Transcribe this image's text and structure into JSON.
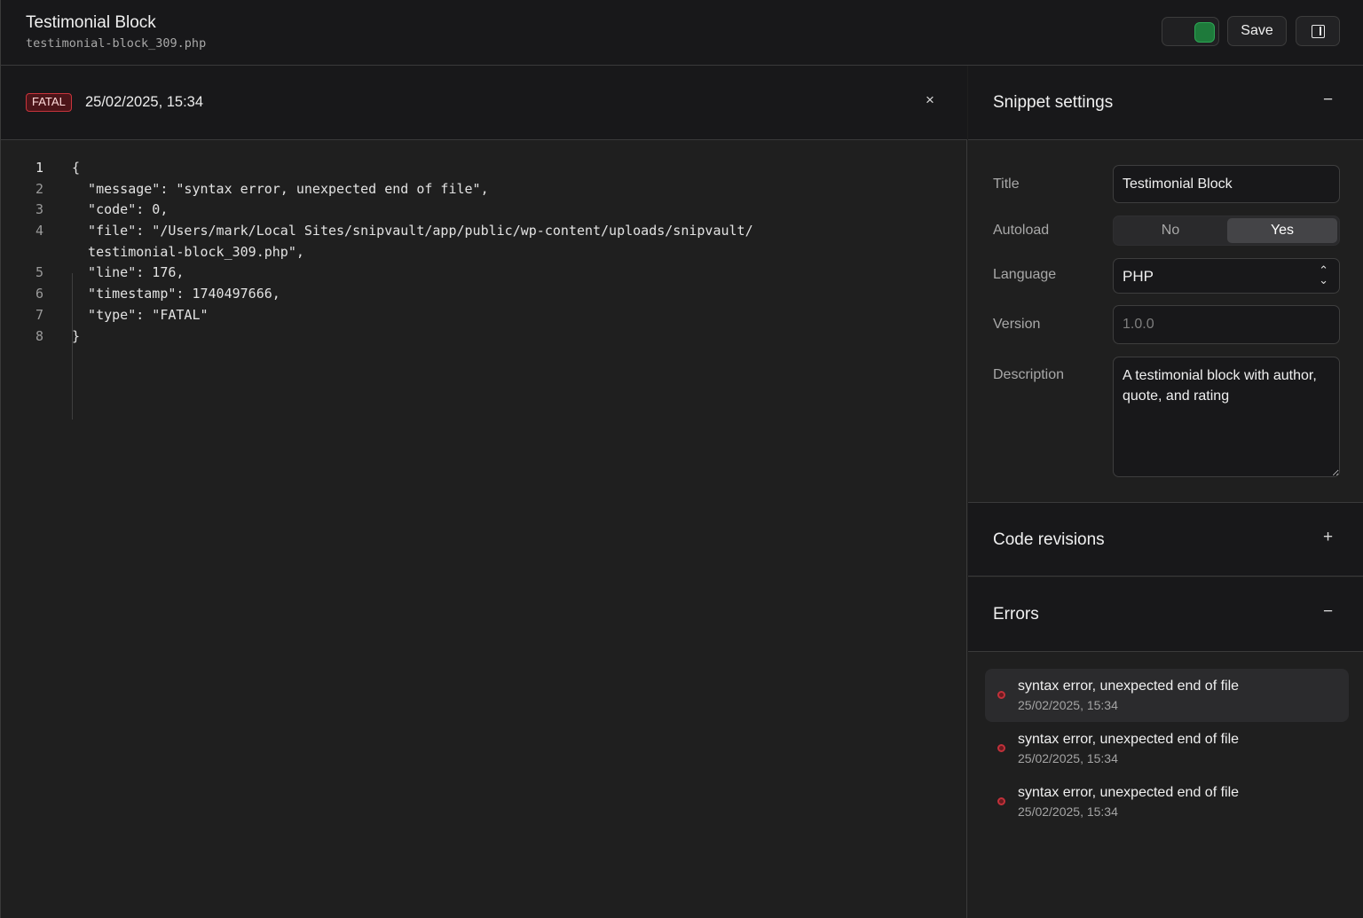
{
  "header": {
    "title": "Testimonial Block",
    "filename": "testimonial-block_309.php",
    "save_label": "Save",
    "toggle_state": "on",
    "accent_color": "#2da654"
  },
  "error_view": {
    "badge": "FATAL",
    "date": "25/02/2025, 15:34",
    "close_icon": "close-icon",
    "close_glyph": "×",
    "code_lines": [
      {
        "num": "1",
        "text": "{"
      },
      {
        "num": "2",
        "text": "  \"message\": \"syntax error, unexpected end of file\","
      },
      {
        "num": "3",
        "text": "  \"code\": 0,"
      },
      {
        "num": "4",
        "text": "  \"file\": \"/Users/mark/Local Sites/snipvault/app/public/wp-content/uploads/snipvault/"
      },
      {
        "num": "",
        "text": "  testimonial-block_309.php\","
      },
      {
        "num": "5",
        "text": "  \"line\": 176,"
      },
      {
        "num": "6",
        "text": "  \"timestamp\": 1740497666,"
      },
      {
        "num": "7",
        "text": "  \"type\": \"FATAL\""
      },
      {
        "num": "8",
        "text": "}"
      }
    ]
  },
  "settings": {
    "heading": "Snippet settings",
    "collapse_symbol": "−",
    "title_label": "Title",
    "title_value": "Testimonial Block",
    "autoload_label": "Autoload",
    "autoload_options": [
      "No",
      "Yes"
    ],
    "autoload_selected": "Yes",
    "language_label": "Language",
    "language_value": "PHP",
    "version_label": "Version",
    "version_placeholder": "1.0.0",
    "description_label": "Description",
    "description_value": "A testimonial block with author, quote, and rating"
  },
  "revisions": {
    "heading": "Code revisions",
    "expand_symbol": "+"
  },
  "errors": {
    "heading": "Errors",
    "collapse_symbol": "−",
    "items": [
      {
        "message": "syntax error, unexpected end of file",
        "time": "25/02/2025, 15:34"
      },
      {
        "message": "syntax error, unexpected end of file",
        "time": "25/02/2025, 15:34"
      },
      {
        "message": "syntax error, unexpected end of file",
        "time": "25/02/2025, 15:34"
      }
    ],
    "status_color": "#c1313a"
  }
}
